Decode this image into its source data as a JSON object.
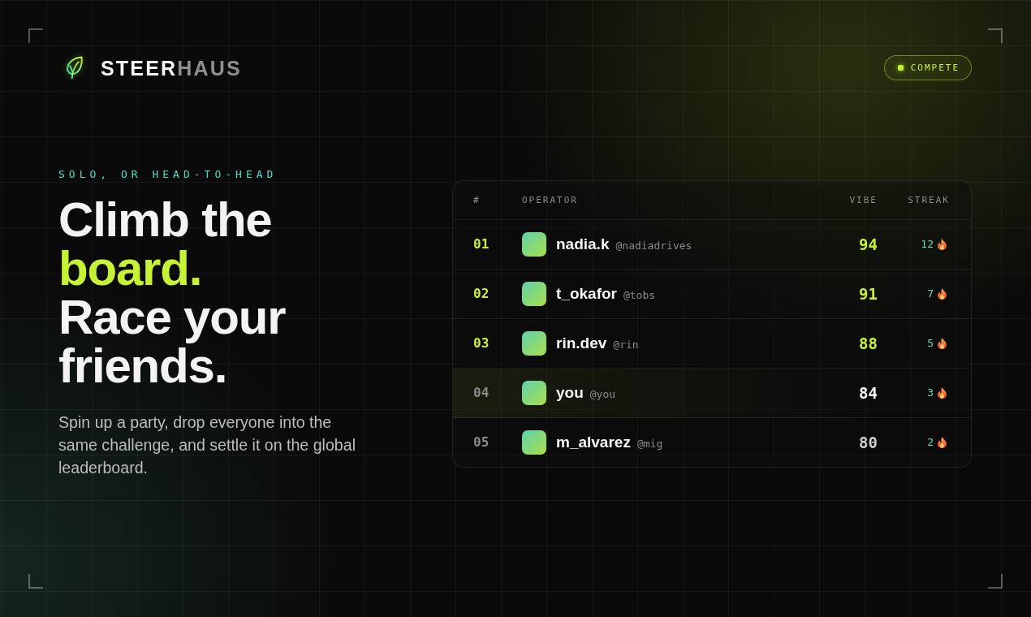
{
  "brand": {
    "name": [
      {
        "text": "STEER",
        "muted": false
      },
      {
        "text": "HAUS",
        "muted": true
      }
    ]
  },
  "header": {
    "button": {
      "label": "COMPETE"
    }
  },
  "hero": {
    "eyebrow": "SOLO, OR HEAD-TO-HEAD",
    "headline": [
      {
        "text": "Climb the",
        "accent": false
      },
      {
        "text": "board.",
        "accent": true
      },
      {
        "text": "Race your friends.",
        "accent": false
      }
    ],
    "description": "Spin up a party, drop everyone into the same challenge, and settle it on the global leaderboard."
  },
  "leaderboard": {
    "columns": [
      "#",
      "OPERATOR",
      "VIBE",
      "STREAK"
    ],
    "rows": [
      {
        "rank": "01",
        "name": "nadia.k",
        "handle": "@nadiadrives",
        "vibe": "94",
        "streak": "12",
        "podium": true,
        "highlighted": false
      },
      {
        "rank": "02",
        "name": "t_okafor",
        "handle": "@tobs",
        "vibe": "91",
        "streak": "7",
        "podium": true,
        "highlighted": false
      },
      {
        "rank": "03",
        "name": "rin.dev",
        "handle": "@rin",
        "vibe": "88",
        "streak": "5",
        "podium": true,
        "highlighted": false
      },
      {
        "rank": "04",
        "name": "you",
        "handle": "@you",
        "vibe": "84",
        "streak": "3",
        "podium": false,
        "highlighted": true
      },
      {
        "rank": "05",
        "name": "m_alvarez",
        "handle": "@mig",
        "vibe": "80",
        "streak": "2",
        "podium": false,
        "highlighted": false
      }
    ]
  }
}
